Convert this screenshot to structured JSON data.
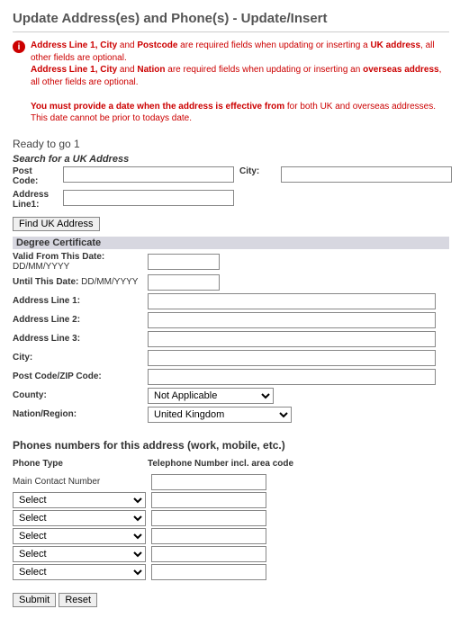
{
  "title": "Update Address(es) and Phone(s) - Update/Insert",
  "info": {
    "line1_pre": "Address Line 1, City",
    "line1_mid": " and ",
    "line1_post": "Postcode",
    "line1_tail": " are required fields when updating or inserting a ",
    "line1_uk": "UK address",
    "line1_end": ", all other fields are optional.",
    "line2_pre": "Address Line 1, City",
    "line2_mid": " and ",
    "line2_post": "Nation",
    "line2_tail": " are required fields when updating or inserting an ",
    "line2_ov": "overseas address",
    "line2_end": ", all other fields are optional.",
    "line3": "You must provide a date when the address is effective from",
    "line3_tail": " for both UK and overseas addresses.",
    "line4": "This date cannot be prior to todays date."
  },
  "ready": "Ready to go 1",
  "search": {
    "heading": "Search for a UK Address",
    "postcode_label": "Post Code:",
    "city_label": "City:",
    "addr1_label": "Address Line1:",
    "button": "Find UK Address"
  },
  "cert": {
    "band": "Degree Certificate",
    "valid_from_label": "Valid From This Date:",
    "valid_from_hint": "DD/MM/YYYY",
    "until_label": "Until This Date:",
    "until_hint": "DD/MM/YYYY",
    "addr1": "Address Line 1:",
    "addr2": "Address Line 2:",
    "addr3": "Address Line 3:",
    "city": "City:",
    "zip": "Post Code/ZIP Code:",
    "county": "County:",
    "county_value": "Not Applicable",
    "nation": "Nation/Region:",
    "nation_value": "United Kingdom"
  },
  "phones": {
    "heading": "Phones numbers for this address (work, mobile, etc.)",
    "col_type": "Phone Type",
    "col_num": "Telephone Number incl. area code",
    "main_label": "Main Contact Number",
    "select_default": "Select"
  },
  "buttons": {
    "submit": "Submit",
    "reset": "Reset"
  }
}
